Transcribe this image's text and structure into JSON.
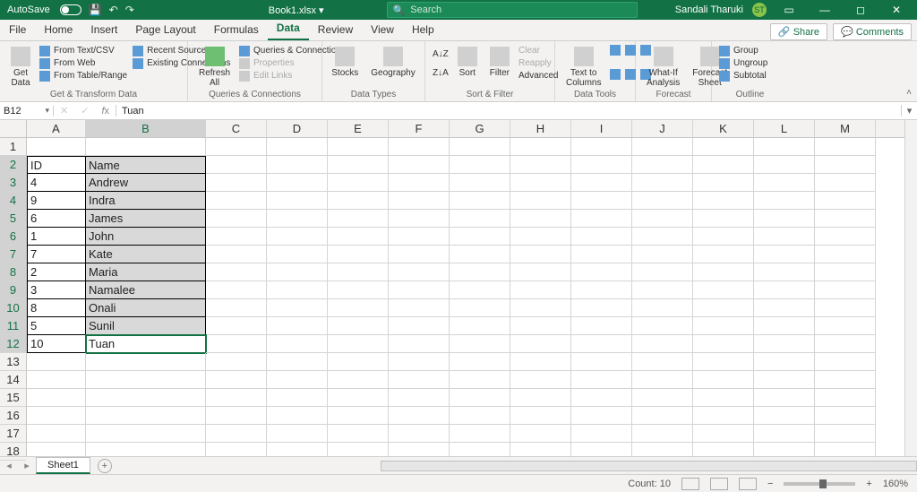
{
  "titlebar": {
    "autosave": "AutoSave",
    "autosave_state": "Off",
    "doc_name": "Book1.xlsx",
    "search_placeholder": "Search",
    "user_name": "Sandali Tharuki",
    "user_initials": "ST"
  },
  "tabs": {
    "file": "File",
    "home": "Home",
    "insert": "Insert",
    "page_layout": "Page Layout",
    "formulas": "Formulas",
    "data": "Data",
    "review": "Review",
    "view": "View",
    "help": "Help",
    "share": "Share",
    "comments": "Comments"
  },
  "ribbon": {
    "get_data": "Get\nData",
    "from_text": "From Text/CSV",
    "from_web": "From Web",
    "from_table": "From Table/Range",
    "recent": "Recent Sources",
    "existing": "Existing Connections",
    "group_get": "Get & Transform Data",
    "refresh": "Refresh\nAll",
    "queries": "Queries & Connections",
    "properties": "Properties",
    "edit_links": "Edit Links",
    "group_queries": "Queries & Connections",
    "stocks": "Stocks",
    "geography": "Geography",
    "group_types": "Data Types",
    "sort": "Sort",
    "filter": "Filter",
    "clear": "Clear",
    "reapply": "Reapply",
    "advanced": "Advanced",
    "group_sort": "Sort & Filter",
    "text_to_cols": "Text to\nColumns",
    "group_tools": "Data Tools",
    "whatif": "What-If\nAnalysis",
    "forecast_sheet": "Forecast\nSheet",
    "group_forecast": "Forecast",
    "grp": "Group",
    "ungrp": "Ungroup",
    "subtotal": "Subtotal",
    "group_outline": "Outline"
  },
  "fbar": {
    "namebox": "B12",
    "formula": "Tuan"
  },
  "columns": [
    "A",
    "B",
    "C",
    "D",
    "E",
    "F",
    "G",
    "H",
    "I",
    "J",
    "K",
    "L",
    "M"
  ],
  "col_widths": [
    "colA",
    "colB",
    "",
    "",
    "",
    "",
    "",
    "",
    "",
    "",
    "",
    "",
    ""
  ],
  "rows_visible": 18,
  "data_rows": [
    {
      "r": 2,
      "A": "ID",
      "B": "Name"
    },
    {
      "r": 3,
      "A": "4",
      "B": "Andrew"
    },
    {
      "r": 4,
      "A": "9",
      "B": "Indra"
    },
    {
      "r": 5,
      "A": "6",
      "B": "James"
    },
    {
      "r": 6,
      "A": "1",
      "B": "John"
    },
    {
      "r": 7,
      "A": "7",
      "B": "Kate"
    },
    {
      "r": 8,
      "A": "2",
      "B": "Maria"
    },
    {
      "r": 9,
      "A": "3",
      "B": "Namalee"
    },
    {
      "r": 10,
      "A": "8",
      "B": "Onali"
    },
    {
      "r": 11,
      "A": "5",
      "B": "Sunil"
    },
    {
      "r": 12,
      "A": "10",
      "B": "Tuan"
    }
  ],
  "active_cell": "B12",
  "selection": {
    "col": "B",
    "from_row": 2,
    "to_row": 12
  },
  "sheet_tab": "Sheet1",
  "status": {
    "count_label": "Count:",
    "count_value": "10",
    "zoom": "160%"
  }
}
